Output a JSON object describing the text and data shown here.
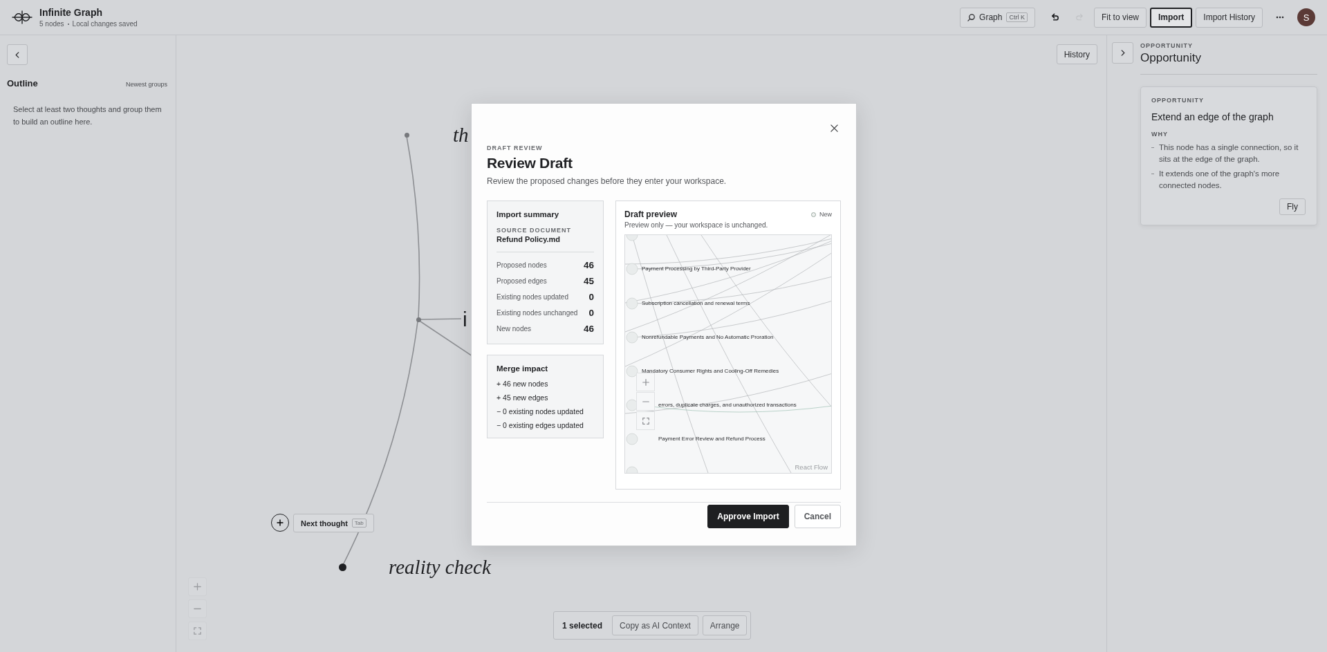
{
  "topbar": {
    "title": "Infinite Graph",
    "status": [
      "5 nodes",
      "Local changes saved"
    ],
    "search": {
      "label": "Graph",
      "shortcut": "Ctrl K"
    },
    "history_buttons": [
      {
        "kind": "undo",
        "disabled": false
      },
      {
        "kind": "redo",
        "disabled": true
      }
    ],
    "buttons": [
      {
        "label": "Fit to view",
        "selected": false
      },
      {
        "label": "Import",
        "selected": true
      },
      {
        "label": "Import History",
        "selected": false
      }
    ],
    "avatar": "S"
  },
  "outline": {
    "title": "Outline",
    "sort": "Newest groups",
    "empty_text": "Select at least two thoughts and group them to build an outline here."
  },
  "canvas": {
    "history_button": "History",
    "nodes": [
      {
        "label": "th",
        "kind": "italic",
        "selected": false
      },
      {
        "label": "i",
        "kind": "plain",
        "selected": false
      },
      {
        "label": "reality check",
        "kind": "italic",
        "selected": true
      }
    ],
    "next_thought": {
      "label": "Next thought",
      "shortcut": "Tab"
    },
    "selection_bar": {
      "count": "1 selected",
      "actions": [
        "Copy as AI Context",
        "Arrange"
      ]
    }
  },
  "inspector": {
    "eyebrow": "OPPORTUNITY",
    "title": "Opportunity",
    "card": {
      "eyebrow": "OPPORTUNITY",
      "title": "Extend an edge of the graph",
      "why_label": "WHY",
      "reasons": [
        "This node has a single connection, so it sits at the edge of the graph.",
        "It extends one of the graph's more connected nodes."
      ],
      "action": "Fly"
    }
  },
  "dialog": {
    "eyebrow": "DRAFT REVIEW",
    "title": "Review Draft",
    "subtitle": "Review the proposed changes before they enter your workspace.",
    "summary": {
      "title": "Import summary",
      "source_label": "SOURCE DOCUMENT",
      "source": "Refund Policy.md",
      "stats": [
        {
          "label": "Proposed nodes",
          "value": "46"
        },
        {
          "label": "Proposed edges",
          "value": "45"
        },
        {
          "label": "Existing nodes updated",
          "value": "0"
        },
        {
          "label": "Existing nodes unchanged",
          "value": "0"
        },
        {
          "label": "New nodes",
          "value": "46"
        }
      ]
    },
    "merge": {
      "title": "Merge impact",
      "lines": [
        "+ 46 new nodes",
        "+ 45 new edges",
        "− 0 existing nodes updated",
        "− 0 existing edges updated"
      ]
    },
    "preview": {
      "title": "Draft preview",
      "legend": "New",
      "subtitle": "Preview only — your workspace is unchanged.",
      "node_labels": [
        "Payment Processing by Third-Party Provider",
        "Subscription cancellation and renewal terms",
        "Nonrefundable Payments and No Automatic Proration",
        "Mandatory Consumer Rights and Cooling-Off Remedies",
        "errors, duplicate charges, and unauthorized transactions",
        "Payment Error Review and Refund Process"
      ],
      "attribution": "React Flow"
    },
    "buttons": [
      {
        "label": "Approve Import",
        "kind": "primary"
      },
      {
        "label": "Cancel",
        "kind": "secondary"
      }
    ]
  }
}
